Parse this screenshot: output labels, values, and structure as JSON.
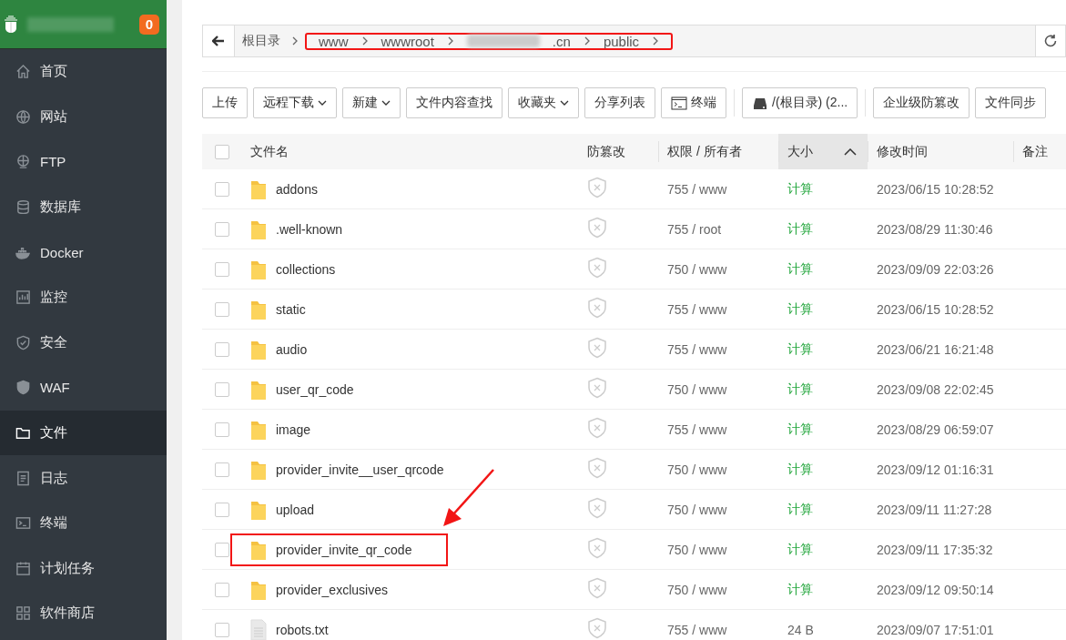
{
  "sidebar": {
    "badge": "0",
    "items": [
      {
        "label": "首页",
        "kind": "home",
        "selected": false
      },
      {
        "label": "网站",
        "kind": "globe",
        "selected": false
      },
      {
        "label": "FTP",
        "kind": "ftp",
        "selected": false
      },
      {
        "label": "数据库",
        "kind": "db",
        "selected": false
      },
      {
        "label": "Docker",
        "kind": "docker",
        "selected": false
      },
      {
        "label": "监控",
        "kind": "monitor",
        "selected": false
      },
      {
        "label": "安全",
        "kind": "shield",
        "selected": false
      },
      {
        "label": "WAF",
        "kind": "waf",
        "selected": false
      },
      {
        "label": "文件",
        "kind": "folder",
        "selected": true
      },
      {
        "label": "日志",
        "kind": "log",
        "selected": false
      },
      {
        "label": "终端",
        "kind": "terminal",
        "selected": false
      },
      {
        "label": "计划任务",
        "kind": "calendar",
        "selected": false
      },
      {
        "label": "软件商店",
        "kind": "apps",
        "selected": false
      }
    ]
  },
  "breadcrumb": {
    "highlighted": true,
    "segments": [
      {
        "text": "根目录",
        "redacted": false
      },
      {
        "text": "www",
        "redacted": false
      },
      {
        "text": "wwwroot",
        "redacted": false
      },
      {
        "text": ".cn",
        "redacted": true
      },
      {
        "text": "public",
        "redacted": false
      }
    ]
  },
  "toolbar": {
    "groups": [
      {
        "buttons": [
          {
            "label": "上传",
            "dropdown": false,
            "kind": "plain"
          },
          {
            "label": "远程下载",
            "dropdown": true,
            "kind": "plain"
          },
          {
            "label": "新建",
            "dropdown": true,
            "kind": "plain"
          },
          {
            "label": "文件内容查找",
            "dropdown": false,
            "kind": "plain"
          },
          {
            "label": "收藏夹",
            "dropdown": true,
            "kind": "plain"
          },
          {
            "label": "分享列表",
            "dropdown": false,
            "kind": "plain"
          },
          {
            "label": "终端",
            "dropdown": false,
            "kind": "terminal"
          }
        ]
      },
      {
        "buttons": [
          {
            "label": "/(根目录) (2...",
            "dropdown": false,
            "kind": "disk"
          }
        ]
      },
      {
        "buttons": [
          {
            "label": "企业级防篡改",
            "dropdown": false,
            "kind": "plain"
          },
          {
            "label": "文件同步",
            "dropdown": false,
            "kind": "plain"
          }
        ]
      }
    ]
  },
  "table": {
    "all_checked": false,
    "columns": [
      {
        "label": "文件名",
        "sorted": false
      },
      {
        "label": "防篡改",
        "sorted": false
      },
      {
        "label": "权限 / 所有者",
        "sorted": false
      },
      {
        "label": "大小",
        "sorted": true
      },
      {
        "label": "修改时间",
        "sorted": false
      },
      {
        "label": "备注",
        "sorted": false
      }
    ],
    "rows": [
      {
        "kind": "folder",
        "name": "addons",
        "perm": "755 / www",
        "size": "计算",
        "modified": "2023/06/15 10:28:52",
        "checked": false,
        "highlighted": false
      },
      {
        "kind": "folder",
        "name": ".well-known",
        "perm": "755 / root",
        "size": "计算",
        "modified": "2023/08/29 11:30:46",
        "checked": false,
        "highlighted": false
      },
      {
        "kind": "folder",
        "name": "collections",
        "perm": "750 / www",
        "size": "计算",
        "modified": "2023/09/09 22:03:26",
        "checked": false,
        "highlighted": false
      },
      {
        "kind": "folder",
        "name": "static",
        "perm": "755 / www",
        "size": "计算",
        "modified": "2023/06/15 10:28:52",
        "checked": false,
        "highlighted": false
      },
      {
        "kind": "folder",
        "name": "audio",
        "perm": "755 / www",
        "size": "计算",
        "modified": "2023/06/21 16:21:48",
        "checked": false,
        "highlighted": false
      },
      {
        "kind": "folder",
        "name": "user_qr_code",
        "perm": "750 / www",
        "size": "计算",
        "modified": "2023/09/08 22:02:45",
        "checked": false,
        "highlighted": false
      },
      {
        "kind": "folder",
        "name": "image",
        "perm": "755 / www",
        "size": "计算",
        "modified": "2023/08/29 06:59:07",
        "checked": false,
        "highlighted": false
      },
      {
        "kind": "folder",
        "name": "provider_invite__user_qrcode",
        "perm": "750 / www",
        "size": "计算",
        "modified": "2023/09/12 01:16:31",
        "checked": false,
        "highlighted": false
      },
      {
        "kind": "folder",
        "name": "upload",
        "perm": "750 / www",
        "size": "计算",
        "modified": "2023/09/11 11:27:28",
        "checked": false,
        "highlighted": false
      },
      {
        "kind": "folder",
        "name": "provider_invite_qr_code",
        "perm": "750 / www",
        "size": "计算",
        "modified": "2023/09/11 17:35:32",
        "checked": false,
        "highlighted": true
      },
      {
        "kind": "folder",
        "name": "provider_exclusives",
        "perm": "750 / www",
        "size": "计算",
        "modified": "2023/09/12 09:50:14",
        "checked": false,
        "highlighted": false
      },
      {
        "kind": "file",
        "name": "robots.txt",
        "perm": "755 / www",
        "size": "24 B",
        "modified": "2023/09/07 17:51:01",
        "checked": false,
        "highlighted": false
      }
    ]
  }
}
